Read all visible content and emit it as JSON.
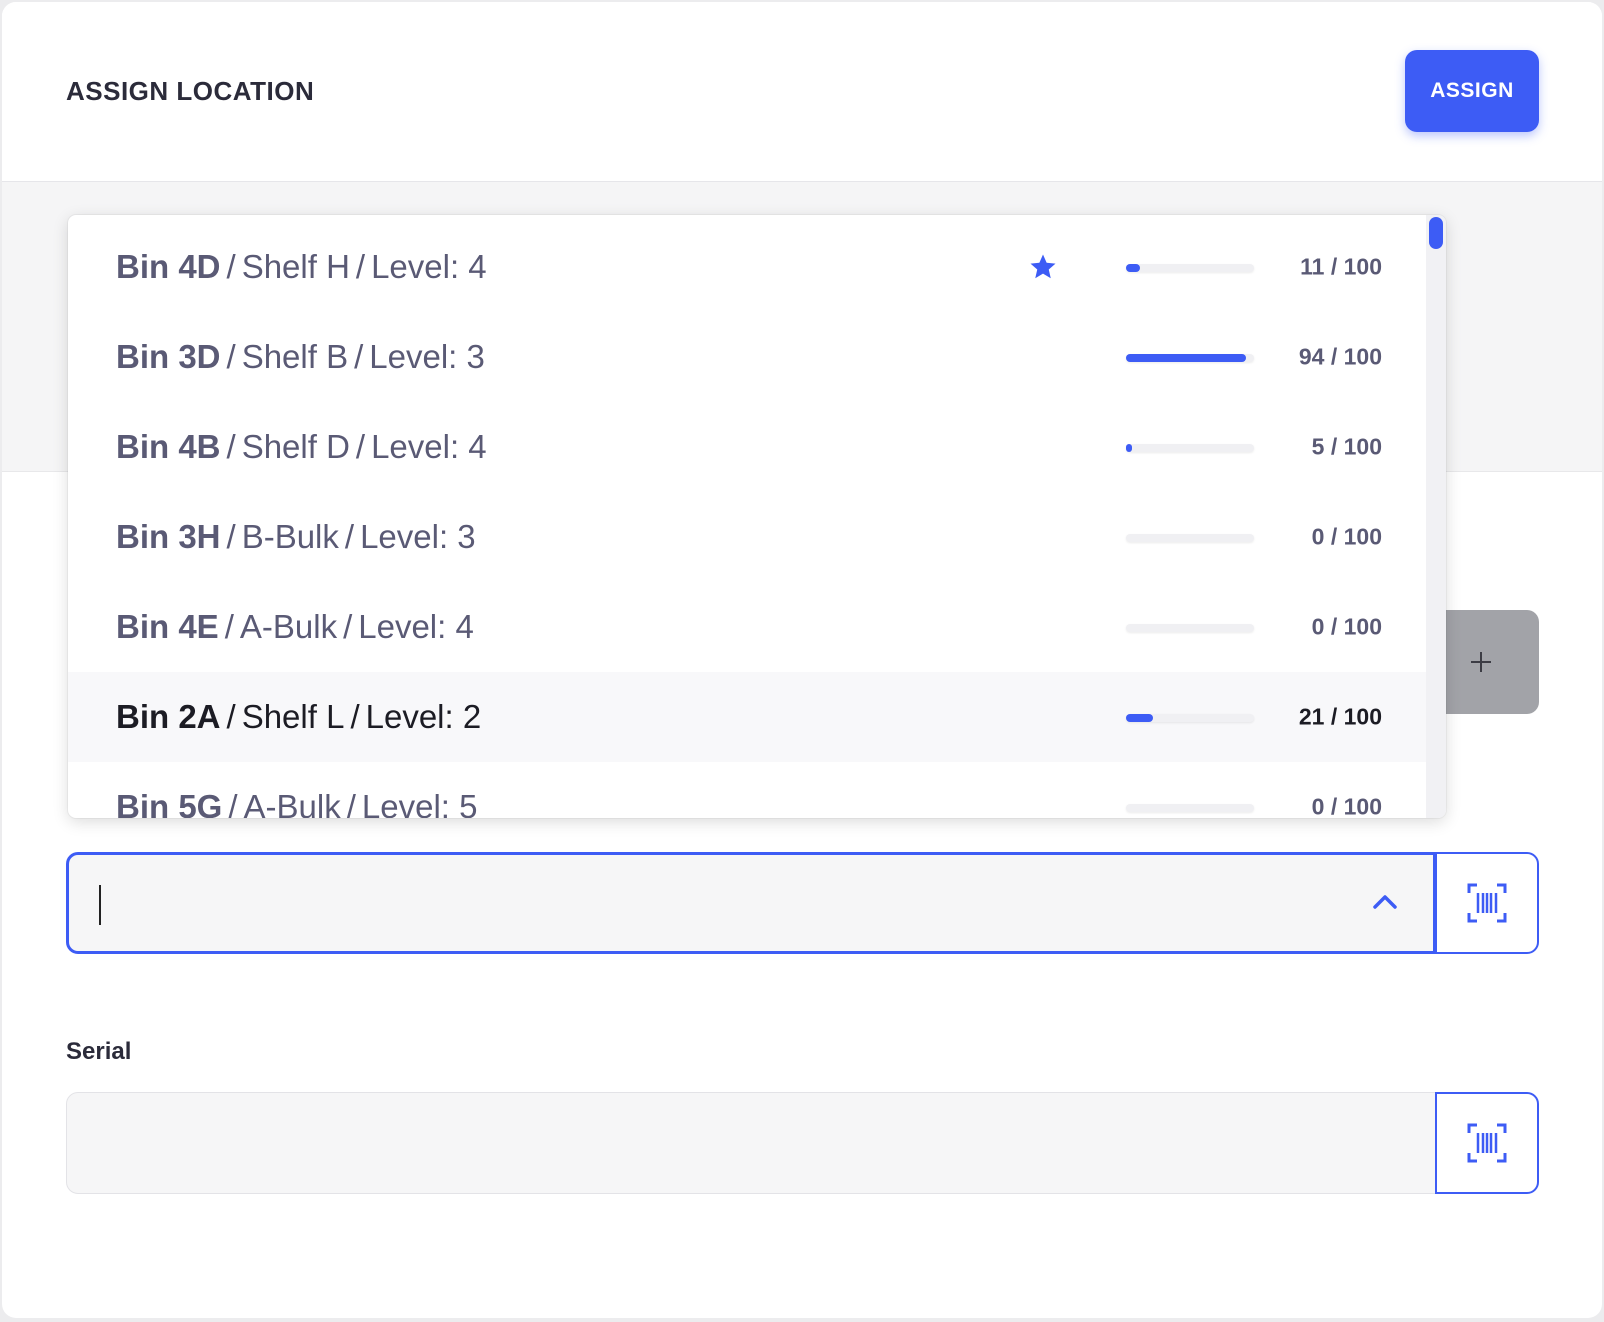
{
  "header": {
    "title": "ASSIGN LOCATION",
    "assign_label": "ASSIGN"
  },
  "add_button": {
    "icon": "plus-icon"
  },
  "dropdown": {
    "items": [
      {
        "bin": "Bin 4D",
        "shelf": "Shelf H",
        "level": "Level: 4",
        "favorite": true,
        "count": "11 / 100",
        "fill": 0.11
      },
      {
        "bin": "Bin 3D",
        "shelf": "Shelf B",
        "level": "Level: 3",
        "favorite": false,
        "count": "94 / 100",
        "fill": 0.94
      },
      {
        "bin": "Bin 4B",
        "shelf": "Shelf D",
        "level": "Level: 4",
        "favorite": false,
        "count": "5 / 100",
        "fill": 0.05
      },
      {
        "bin": "Bin 3H",
        "shelf": "B-Bulk",
        "level": "Level: 3",
        "favorite": false,
        "count": "0 / 100",
        "fill": 0.0
      },
      {
        "bin": "Bin 4E",
        "shelf": "A-Bulk",
        "level": "Level: 4",
        "favorite": false,
        "count": "0 / 100",
        "fill": 0.0
      },
      {
        "bin": "Bin 2A",
        "shelf": "Shelf L",
        "level": "Level: 2",
        "favorite": false,
        "count": "21 / 100",
        "fill": 0.21,
        "highlighted": true
      },
      {
        "bin": "Bin 5G",
        "shelf": "A-Bulk",
        "level": "Level: 5",
        "favorite": false,
        "count": "0 / 100",
        "fill": 0.0
      }
    ]
  },
  "location_input": {
    "value": "",
    "icon": "chevron-up-icon",
    "scan_icon": "barcode-scan-icon"
  },
  "serial": {
    "label": "Serial",
    "value": "",
    "scan_icon": "barcode-scan-icon"
  },
  "colors": {
    "accent": "#3d5cf5",
    "text": "#5a5a75",
    "text_dark": "#1c1c24"
  }
}
